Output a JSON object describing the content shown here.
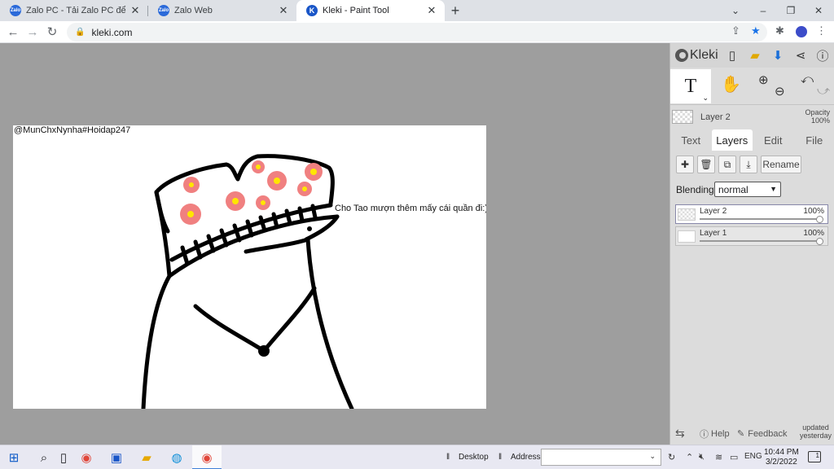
{
  "browser": {
    "tabs": [
      {
        "title": "Zalo PC - Tải Zalo PC để làm việc",
        "favicon": "Zalo"
      },
      {
        "title": "Zalo Web",
        "favicon": "Zalo"
      },
      {
        "title": "Kleki - Paint Tool",
        "favicon": "K"
      }
    ],
    "url": "kleki.com",
    "window_controls": {
      "dropdown": "⌄",
      "minimize": "–",
      "restore": "❐",
      "close": "✕"
    }
  },
  "canvas": {
    "watermark": "@MunChxNynha#Hoidap247",
    "speech": "Cho Tao mượn thêm mấy cái quần đi:)"
  },
  "kleki": {
    "logo": "Kleki",
    "current_layer": "Layer 2",
    "opacity_label": "Opacity",
    "opacity_value": "100%",
    "tool_text_glyph": "T",
    "tabs": [
      "Text",
      "Layers",
      "Edit",
      "File"
    ],
    "active_tab": "Layers",
    "rename_label": "Rename",
    "blending_label": "Blending",
    "blending_value": "normal",
    "layers": [
      {
        "name": "Layer 2",
        "opacity": "100%",
        "selected": true
      },
      {
        "name": "Layer 1",
        "opacity": "100%",
        "selected": false
      }
    ],
    "help_label": "Help",
    "feedback_label": "Feedback",
    "updated_line1": "updated",
    "updated_line2": "yesterday"
  },
  "taskbar": {
    "desktop_label": "Desktop",
    "address_label": "Address",
    "language": "ENG",
    "time": "10:44 PM",
    "date": "3/2/2022",
    "notification_count": "1"
  },
  "colors": {
    "flower_pink": "#f08080",
    "flower_center": "#ffe600",
    "tab_accent": "#1a73e8"
  }
}
